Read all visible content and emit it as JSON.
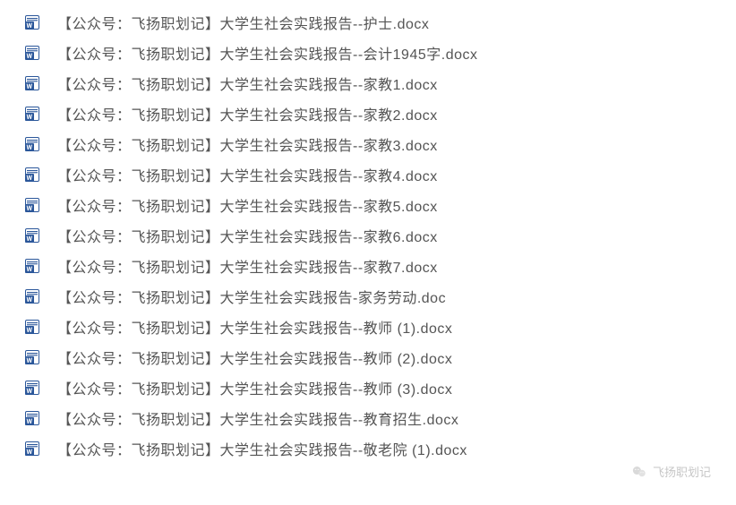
{
  "files": [
    {
      "name": "【公众号：飞扬职划记】大学生社会实践报告--护士.docx",
      "type": "docx"
    },
    {
      "name": "【公众号：飞扬职划记】大学生社会实践报告--会计1945字.docx",
      "type": "docx"
    },
    {
      "name": "【公众号：飞扬职划记】大学生社会实践报告--家教1.docx",
      "type": "docx"
    },
    {
      "name": "【公众号：飞扬职划记】大学生社会实践报告--家教2.docx",
      "type": "docx"
    },
    {
      "name": "【公众号：飞扬职划记】大学生社会实践报告--家教3.docx",
      "type": "docx"
    },
    {
      "name": "【公众号：飞扬职划记】大学生社会实践报告--家教4.docx",
      "type": "docx"
    },
    {
      "name": "【公众号：飞扬职划记】大学生社会实践报告--家教5.docx",
      "type": "docx"
    },
    {
      "name": "【公众号：飞扬职划记】大学生社会实践报告--家教6.docx",
      "type": "docx"
    },
    {
      "name": "【公众号：飞扬职划记】大学生社会实践报告--家教7.docx",
      "type": "docx"
    },
    {
      "name": "【公众号：飞扬职划记】大学生社会实践报告-家务劳动.doc",
      "type": "doc"
    },
    {
      "name": "【公众号：飞扬职划记】大学生社会实践报告--教师 (1).docx",
      "type": "docx"
    },
    {
      "name": "【公众号：飞扬职划记】大学生社会实践报告--教师 (2).docx",
      "type": "docx"
    },
    {
      "name": "【公众号：飞扬职划记】大学生社会实践报告--教师 (3).docx",
      "type": "docx"
    },
    {
      "name": "【公众号：飞扬职划记】大学生社会实践报告--教育招生.docx",
      "type": "docx"
    },
    {
      "name": "【公众号：飞扬职划记】大学生社会实践报告--敬老院 (1).docx",
      "type": "docx"
    }
  ],
  "watermark": {
    "text": "飞扬职划记"
  }
}
